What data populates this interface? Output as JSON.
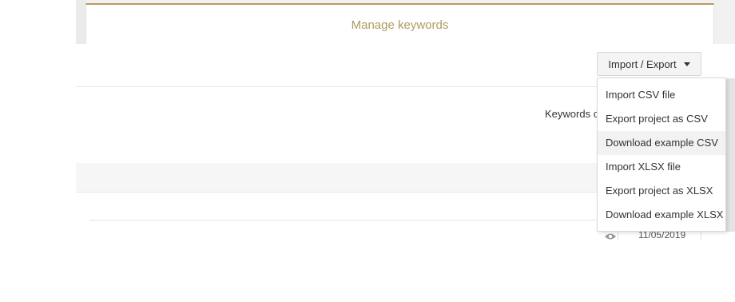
{
  "tabs": {
    "active_title": "Manage keywords"
  },
  "toolbar": {
    "import_export_label": "Import / Export"
  },
  "content": {
    "keywords_label": "Keywords c",
    "date_value": "11/05/2019"
  },
  "dropdown": {
    "items": [
      {
        "label": "Import CSV file"
      },
      {
        "label": "Export project as CSV"
      },
      {
        "label": "Download example CSV"
      },
      {
        "label": "Import XLSX file"
      },
      {
        "label": "Export project as XLSX"
      },
      {
        "label": "Download example XLSX"
      }
    ],
    "hovered_index": 2
  },
  "colors": {
    "tab_accent": "#b89a5a",
    "tab_title": "#b09a5e"
  },
  "icons": {
    "row_view": "eye-icon",
    "dropdown_toggle": "caret-down-icon"
  }
}
